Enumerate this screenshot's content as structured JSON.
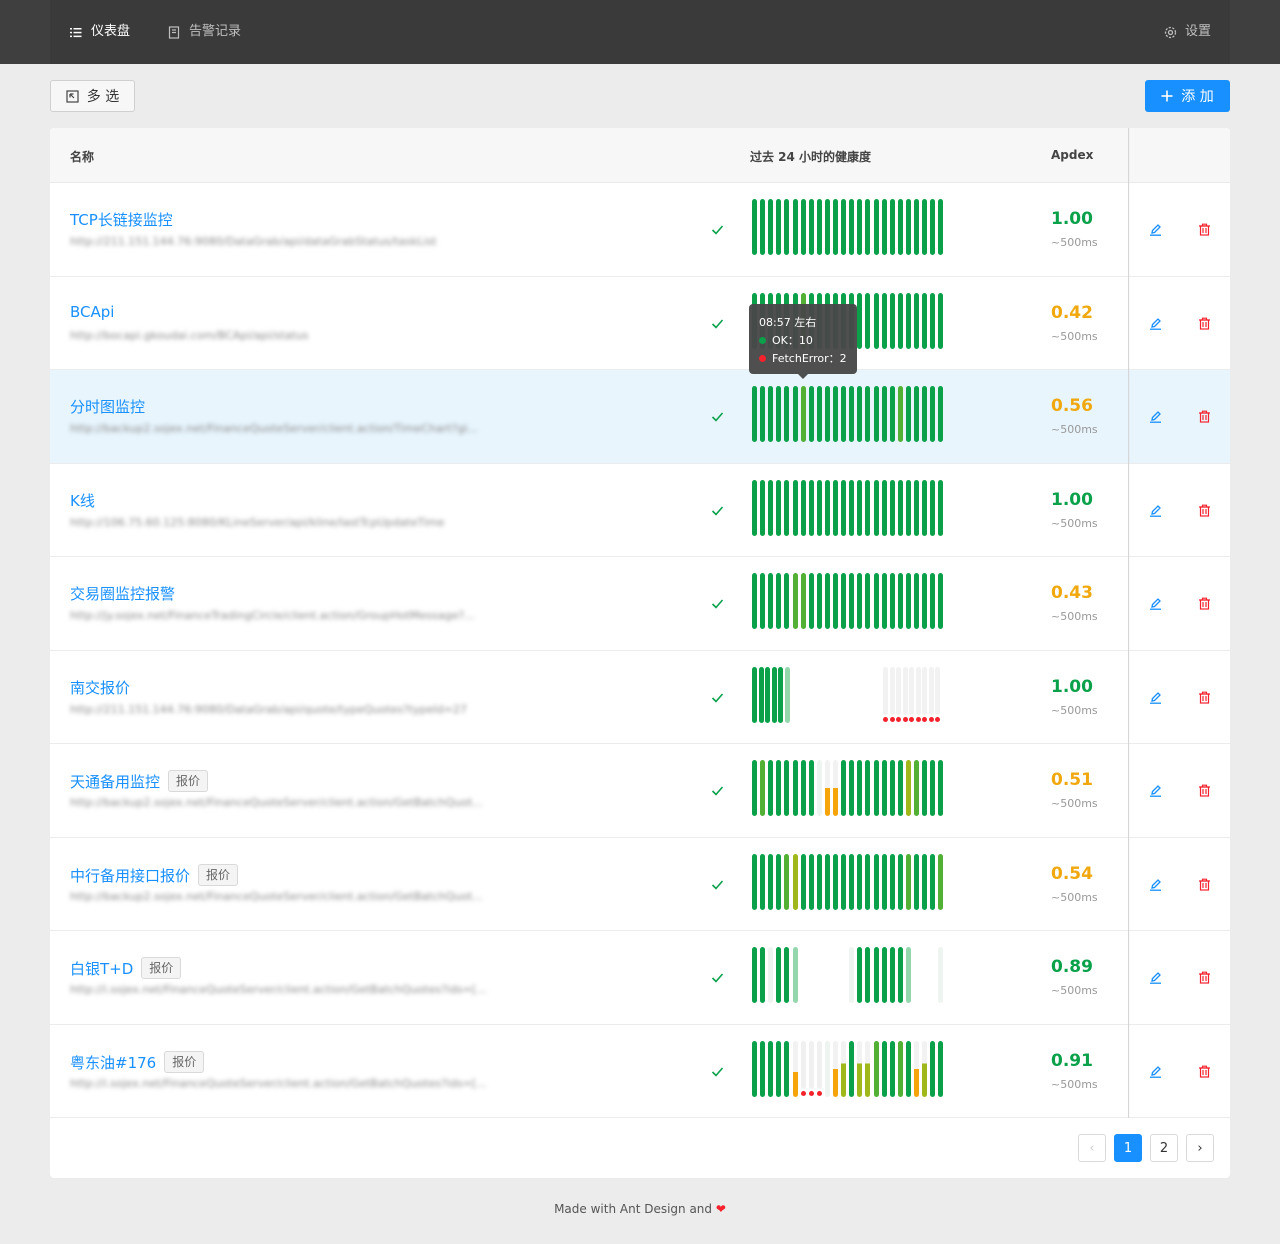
{
  "nav": {
    "dashboard": "仪表盘",
    "alerts": "告警记录",
    "settings": "设置"
  },
  "toolbar": {
    "multi_select": "多 选",
    "add": "添 加"
  },
  "table": {
    "col_name": "名称",
    "col_health": "过去 24 小时的健康度",
    "col_apdex": "Apdex",
    "rows": [
      {
        "name": "TCP长链接监控",
        "tag": "",
        "url": "http://211.151.144.76:9080/DataGrab/api/dataGrabStatus/taskList",
        "apdex": "1.00",
        "ms": "~500ms",
        "apdex_color": "#0aa14a",
        "pattern": "GGGGGGGGGGGGGGGGGGGGGGGG"
      },
      {
        "name": "BCApi",
        "tag": "",
        "url": "http://bocapi.gkoudai.com/BCApi/api/status",
        "apdex": "0.42",
        "ms": "~500ms",
        "apdex_color": "#f0a80e",
        "pattern": "GGGGGGLGGGGGGGGGGGGGGGGG"
      },
      {
        "name": "分时图监控",
        "tag": "",
        "url": "http://backup2.sojex.net/FinanceQuoteServer/client.action/TimeChart?gi...",
        "apdex": "0.56",
        "ms": "~500ms",
        "apdex_color": "#f0a80e",
        "pattern": "GGGGGGLGGGGGGGGGGGLGGGGG"
      },
      {
        "name": "K线",
        "tag": "",
        "url": "http://106.75.60.125:8080/KLineServer/api/kline/lastTcpUpdateTime",
        "apdex": "1.00",
        "ms": "~500ms",
        "apdex_color": "#0aa14a",
        "pattern": "GGGGGGGGGGGGGGGGGGGGGGGG"
      },
      {
        "name": "交易圈监控报警",
        "tag": "",
        "url": "http://jy.sojex.net/FinanceTradingCircle/client.action/GroupHotMessage?...",
        "apdex": "0.43",
        "ms": "~500ms",
        "apdex_color": "#f0a80e",
        "pattern": "GGGGGLLGGGGGGGGGGGGGGGGG"
      },
      {
        "name": "南交报价",
        "tag": "",
        "url": "http://211.151.144.76:9080/DataGrab/api/quote/typeQuotes?typeId=27",
        "apdex": "1.00",
        "ms": "~500ms",
        "apdex_color": "#0aa14a",
        "pattern": "GGGGGP..............EEEEEEEEE"
      },
      {
        "name": "天通备用监控",
        "tag": "报价",
        "url": "http://backup2.sojex.net/FinanceQuoteServer/client.action/GetBatchQuot...",
        "apdex": "0.51",
        "ms": "~500ms",
        "apdex_color": "#f0a80e",
        "pattern": "GLGGGGGGEOOGGGGGGGGYLGGG"
      },
      {
        "name": "中行备用接口报价",
        "tag": "报价",
        "url": "http://backup2.sojex.net/FinanceQuoteServer/client.action/GetBatchQuot...",
        "apdex": "0.54",
        "ms": "~500ms",
        "apdex_color": "#f0a80e",
        "pattern": "GGGGLYGGGGGGGGGGGGGLGGGL"
      },
      {
        "name": "白银T+D",
        "tag": "报价",
        "url": "http://i.sojex.net/FinanceQuoteServer/client.action/GetBatchQuotes?ids=[...",
        "apdex": "0.89",
        "ms": "~500ms",
        "apdex_color": "#0aa14a",
        "pattern": "GGEGGP......EGGGGGGP...E"
      },
      {
        "name": "粤东油#176",
        "tag": "报价",
        "url": "http://i.sojex.net/FinanceQuoteServer/client.action/GetBatchQuotes?ids=[...",
        "apdex": "0.91",
        "ms": "~500ms",
        "apdex_color": "#0aa14a",
        "pattern": "GGGGGOXXXEOYGYYLGGLGOYGG"
      }
    ]
  },
  "tooltip": {
    "time": "08:57 左右",
    "ok": "OK：10",
    "error": "FetchError：2"
  },
  "pagination": {
    "pages": [
      "1",
      "2"
    ],
    "prev": "‹",
    "next": "›"
  },
  "footer": "Made with Ant Design and ❤"
}
